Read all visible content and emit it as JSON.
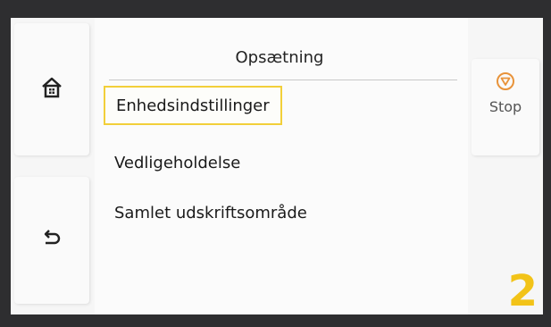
{
  "screen": {
    "title": "Opsætning"
  },
  "menu": {
    "items": [
      {
        "label": "Enhedsindstillinger",
        "selected": true
      },
      {
        "label": "Vedligeholdelse",
        "selected": false
      },
      {
        "label": "Samlet udskriftsområde",
        "selected": false
      }
    ]
  },
  "left_nav": {
    "home_icon": "home-icon",
    "back_icon": "back-arrow-icon"
  },
  "stop": {
    "label": "Stop",
    "icon": "stop-icon",
    "color": "#e8933a"
  },
  "badge": {
    "text": "2",
    "color": "#f2c318"
  },
  "colors": {
    "selection_border": "#f2cf3a"
  }
}
